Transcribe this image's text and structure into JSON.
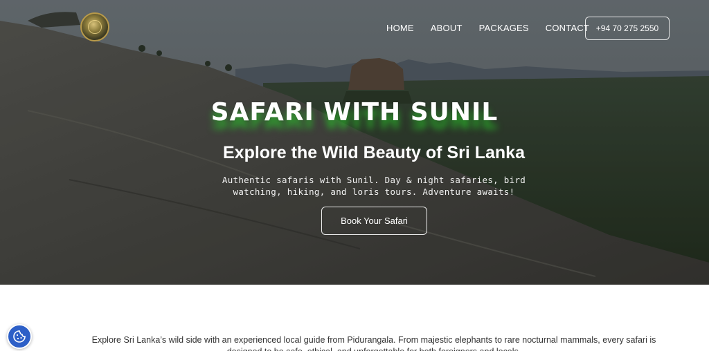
{
  "nav": {
    "items": [
      "HOME",
      "ABOUT",
      "PACKAGES",
      "CONTACT"
    ],
    "phone": "+94 70 275 2550"
  },
  "hero": {
    "title": "SAFARI WITH SUNIL",
    "subtitle": "Explore the Wild Beauty of Sri Lanka",
    "description": "Authentic safaris with Sunil. Day & night safaries, bird watching, hiking, and loris tours. Adventure awaits!",
    "cta": "Book Your Safari"
  },
  "intro": {
    "text": "Explore Sri Lanka’s wild side with an experienced local guide from Pidurangala. From majestic elephants to rare nocturnal mammals, every safari is designed to be safe, ethical, and unforgettable for both foreigners and locals."
  },
  "icons": {
    "logo": "safari-logo-icon",
    "cookie": "cookie-icon"
  },
  "colors": {
    "title_glow": "#28c828",
    "cookie_button": "#2d5fc7"
  }
}
